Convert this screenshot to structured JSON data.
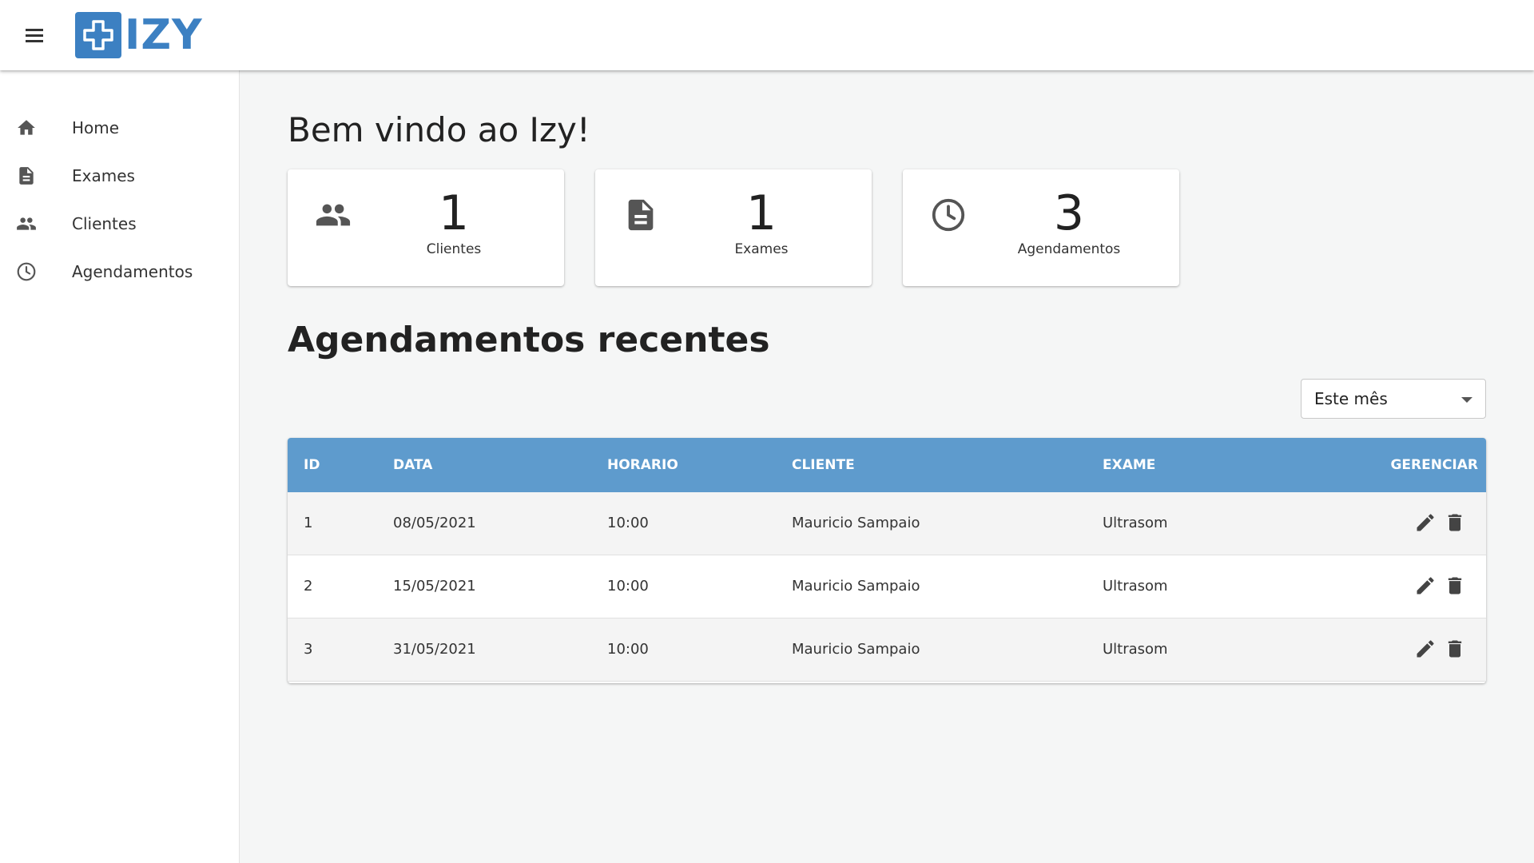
{
  "brand": {
    "logo_text": "IZY",
    "accent_color": "#3c80c2",
    "header_color": "#5e9bcd"
  },
  "sidebar": {
    "items": [
      {
        "label": "Home",
        "icon": "home-icon"
      },
      {
        "label": "Exames",
        "icon": "document-icon"
      },
      {
        "label": "Clientes",
        "icon": "people-icon"
      },
      {
        "label": "Agendamentos",
        "icon": "clock-icon"
      }
    ]
  },
  "main": {
    "title": "Bem vindo ao Izy!",
    "cards": [
      {
        "value": "1",
        "label": "Clientes",
        "icon": "people-icon"
      },
      {
        "value": "1",
        "label": "Exames",
        "icon": "document-icon"
      },
      {
        "value": "3",
        "label": "Agendamentos",
        "icon": "clock-icon"
      }
    ],
    "section_title": "Agendamentos recentes",
    "filter": {
      "selected": "Este mês"
    }
  },
  "table": {
    "headers": {
      "id": "ID",
      "data": "DATA",
      "horario": "HORARIO",
      "cliente": "CLIENTE",
      "exame": "EXAME",
      "gerenciar": "GERENCIAR"
    },
    "rows": [
      {
        "id": "1",
        "data": "08/05/2021",
        "horario": "10:00",
        "cliente": "Mauricio Sampaio",
        "exame": "Ultrasom"
      },
      {
        "id": "2",
        "data": "15/05/2021",
        "horario": "10:00",
        "cliente": "Mauricio Sampaio",
        "exame": "Ultrasom"
      },
      {
        "id": "3",
        "data": "31/05/2021",
        "horario": "10:00",
        "cliente": "Mauricio Sampaio",
        "exame": "Ultrasom"
      }
    ]
  }
}
